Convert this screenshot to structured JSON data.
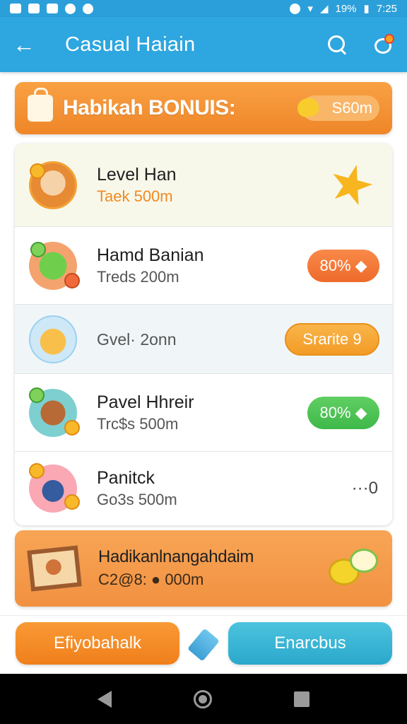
{
  "status_bar": {
    "battery": "19%",
    "time": "7:25"
  },
  "app_bar": {
    "title": "Casual Haiain"
  },
  "bonus_banner": {
    "title": "Habikah BONUIS:",
    "amount": "S60m"
  },
  "rows": [
    {
      "title": "Level Han",
      "subtitle": "Taek 500m"
    },
    {
      "title": "Hamd Banian",
      "subtitle": "Treds 200m",
      "action": "80%"
    },
    {
      "subtitle": "Gvel· 2onn",
      "action": "Srarite 9"
    },
    {
      "title": "Pavel Hhreir",
      "subtitle": "Trc$s 500m",
      "action": "80%"
    },
    {
      "title": "Panitck",
      "subtitle": "Go3s 500m",
      "action": "···0"
    }
  ],
  "reward_banner": {
    "title": "Hadikanlnangahdaim",
    "subtitle": "C2@8: ● 000m"
  },
  "buttons": {
    "left": "Efiyobahalk",
    "right": "Enarcbus"
  },
  "colors": {
    "primary": "#2ea6df",
    "accent_orange": "#f08a2a",
    "green": "#48bd4e"
  }
}
